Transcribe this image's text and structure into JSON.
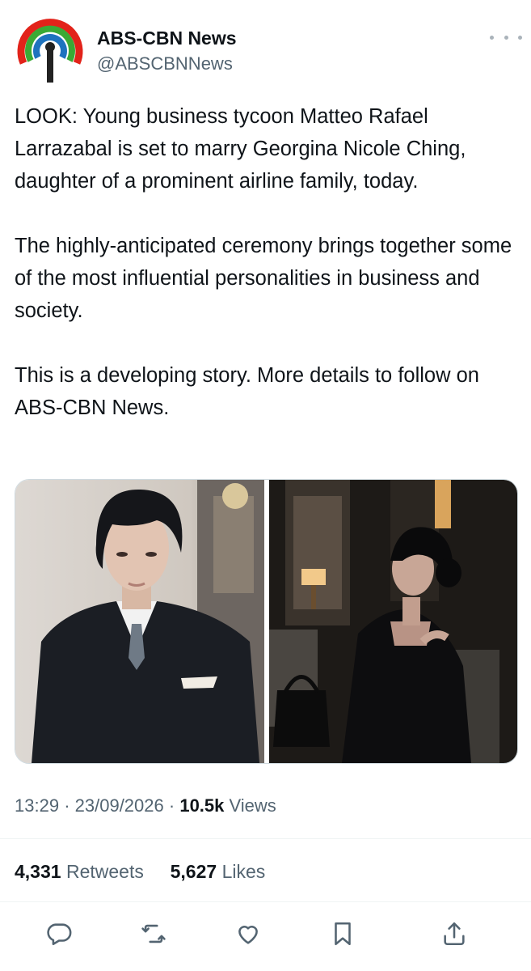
{
  "account": {
    "display_name": "ABS-CBN News",
    "handle": "@ABSCBNNews"
  },
  "tweet": {
    "paragraphs": [
      "LOOK: Young business tycoon Matteo Rafael Larrazabal is set to marry Georgina Nicole Ching, daughter of a prominent airline family, today.",
      "The highly-anticipated ceremony brings together some of the most influential personalities in business and society.",
      "This is a developing story. More details to follow on ABS-CBN News."
    ]
  },
  "meta": {
    "time": "13:29",
    "separator": "·",
    "date": "23/09/2026",
    "views_count": "10.5k",
    "views_label": "Views"
  },
  "stats": {
    "retweets_count": "4,331",
    "retweets_label": "Retweets",
    "likes_count": "5,627",
    "likes_label": "Likes"
  },
  "actions": [
    "reply-icon",
    "retweet-icon",
    "like-icon",
    "bookmark-icon",
    "share-icon"
  ],
  "colors": {
    "text": "#0f1419",
    "secondary": "#536471",
    "logo_red": "#e2231a",
    "logo_green": "#3aaa35",
    "logo_blue": "#1e73be"
  }
}
